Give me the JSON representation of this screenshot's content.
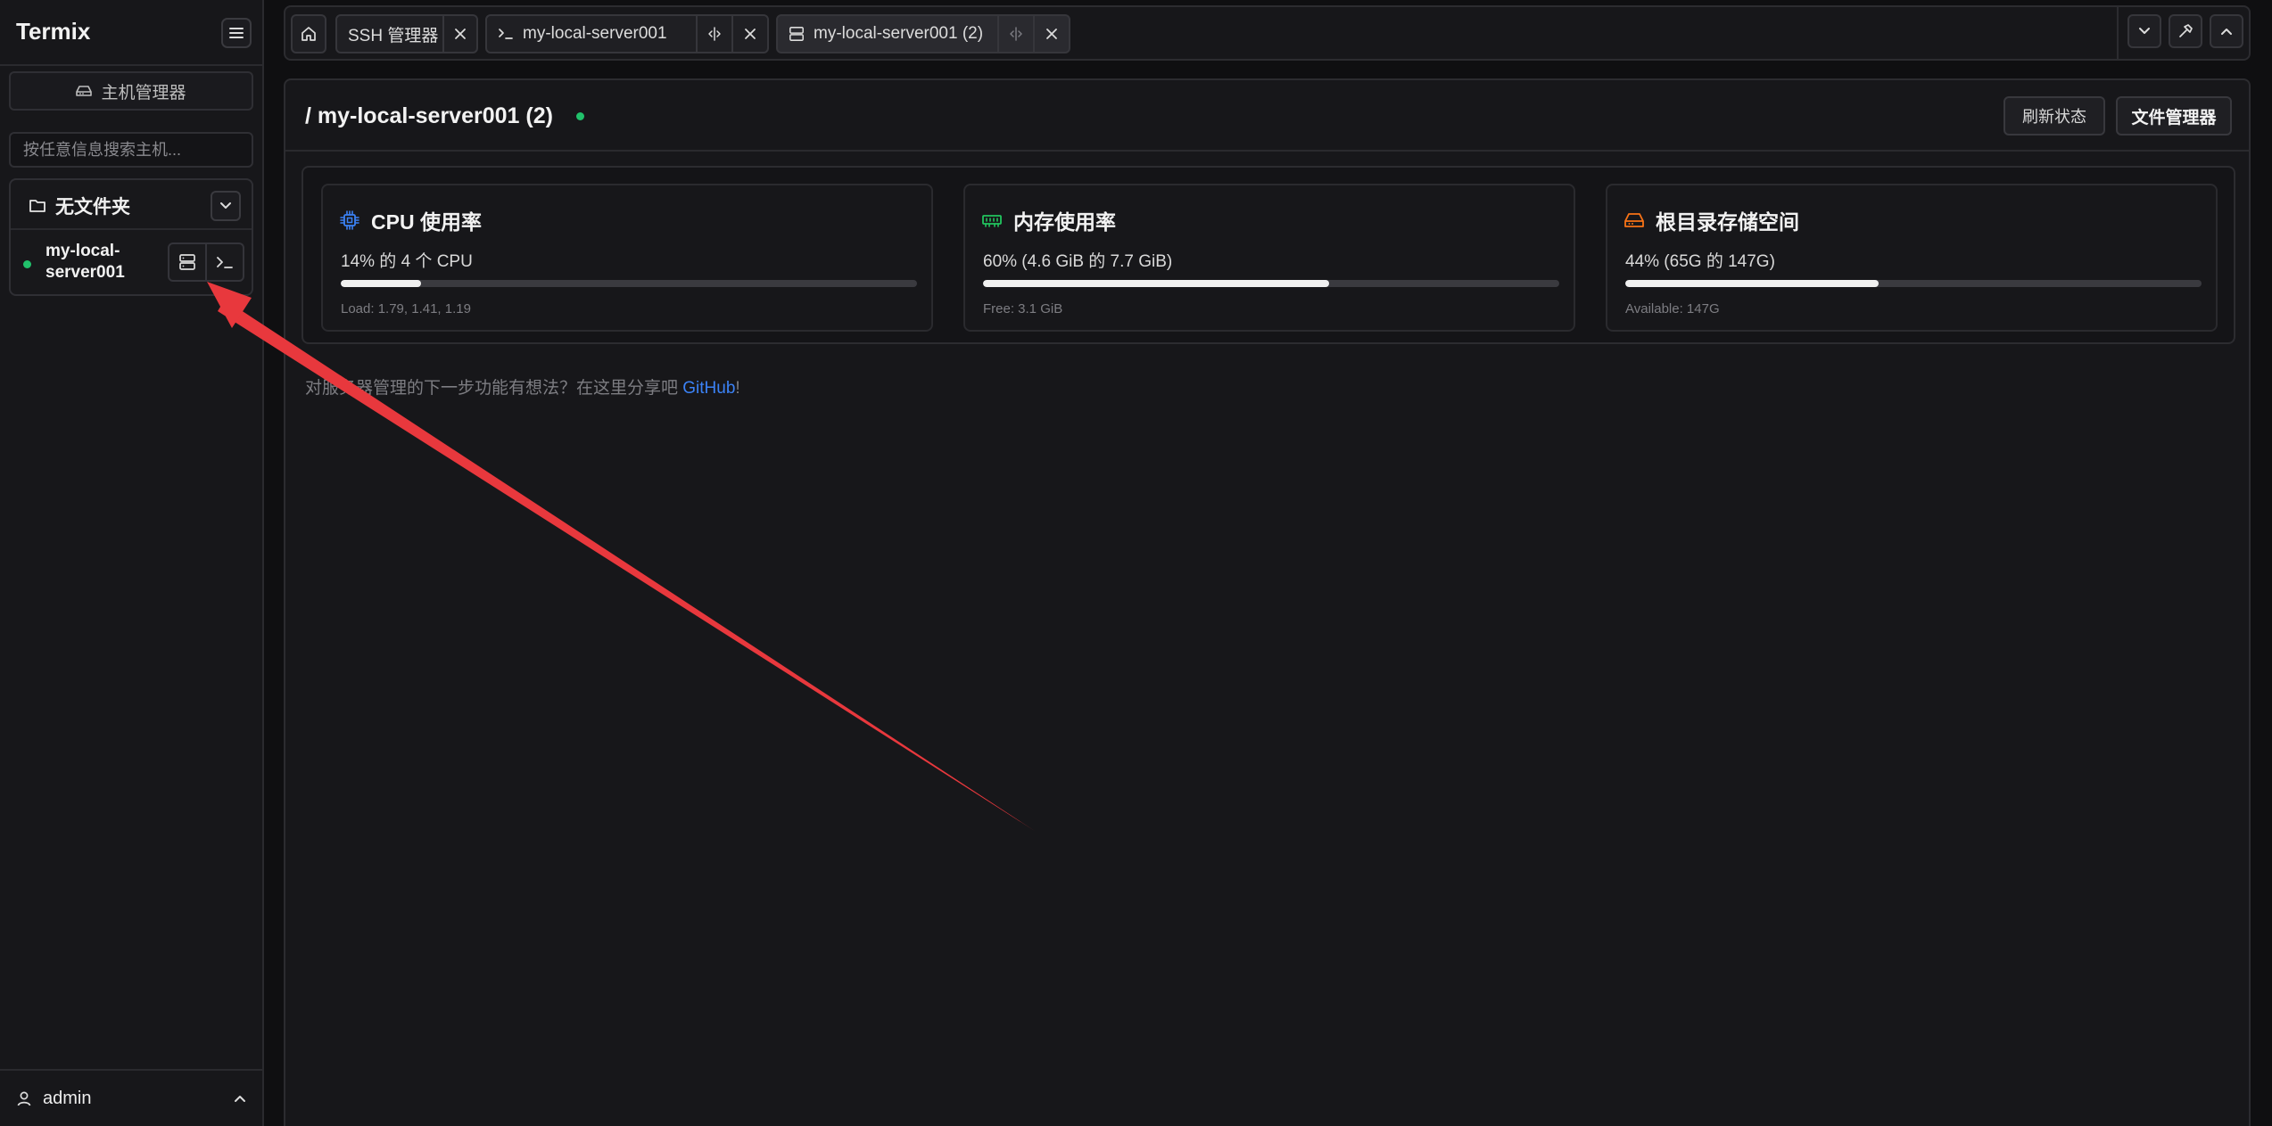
{
  "app": {
    "name": "Termix"
  },
  "sidebar": {
    "host_manager_label": "主机管理器",
    "search_placeholder": "按任意信息搜索主机...",
    "folder": {
      "name": "无文件夹"
    },
    "host": {
      "name": "my-local-server001",
      "status_color": "#21c16b"
    },
    "user": {
      "name": "admin"
    }
  },
  "tabs": [
    {
      "label": "SSH 管理器"
    },
    {
      "label": "my-local-server001"
    },
    {
      "label": "my-local-server001 (2)"
    }
  ],
  "main": {
    "title": "/ my-local-server001 (2)",
    "refresh_label": "刷新状态",
    "file_manager_label": "文件管理器",
    "cards": [
      {
        "title": "CPU 使用率",
        "value": "14% 的 4 个 CPU",
        "percent": 14,
        "sub": "Load: 1.79, 1.41, 1.19",
        "icon": "cpu-icon",
        "icon_color": "#3b82f6"
      },
      {
        "title": "内存使用率",
        "value": "60% (4.6 GiB 的 7.7 GiB)",
        "percent": 60,
        "sub": "Free: 3.1 GiB",
        "icon": "memory-icon",
        "icon_color": "#22c55e"
      },
      {
        "title": "根目录存储空间",
        "value": "44% (65G 的 147G)",
        "percent": 44,
        "sub": "Available: 147G",
        "icon": "disk-icon",
        "icon_color": "#f97316"
      }
    ],
    "feedback": {
      "text": "对服务器管理的下一步功能有想法？在这里分享吧 ",
      "link": "GitHub",
      "suffix": "!"
    }
  },
  "colors": {
    "accent_link": "#3b82f6",
    "annotation_arrow": "#e8383d"
  }
}
